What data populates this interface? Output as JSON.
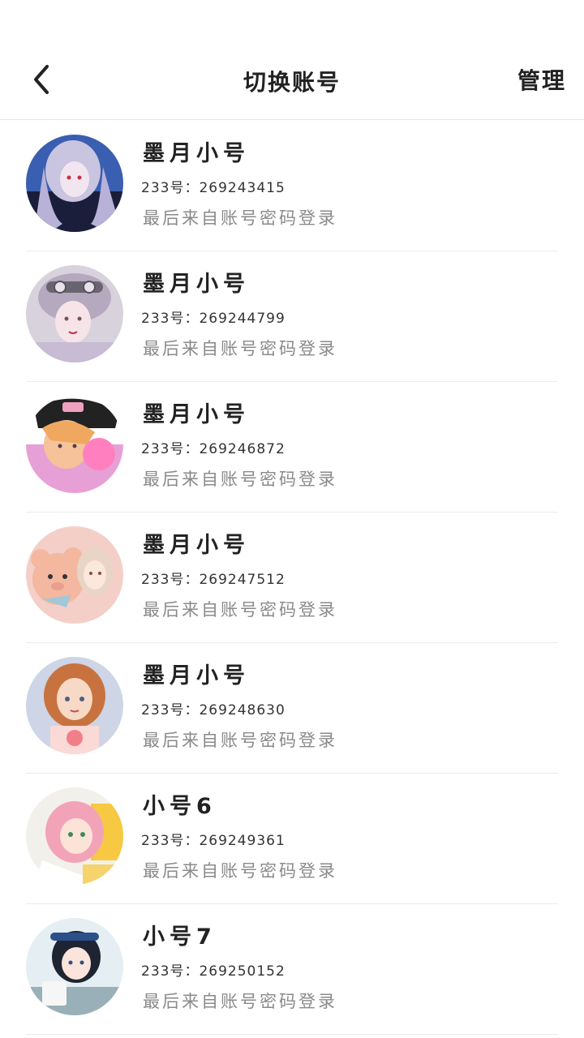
{
  "header": {
    "title": "切换账号",
    "manage_label": "管理",
    "back_icon": "chevron-left-icon"
  },
  "accounts": [
    {
      "name": "墨月小号",
      "id_line": "233号：269243415",
      "source": "最后来自账号密码登录"
    },
    {
      "name": "墨月小号",
      "id_line": "233号：269244799",
      "source": "最后来自账号密码登录"
    },
    {
      "name": "墨月小号",
      "id_line": "233号：269246872",
      "source": "最后来自账号密码登录"
    },
    {
      "name": "墨月小号",
      "id_line": "233号：269247512",
      "source": "最后来自账号密码登录"
    },
    {
      "name": "墨月小号",
      "id_line": "233号：269248630",
      "source": "最后来自账号密码登录"
    },
    {
      "name": "小号6",
      "id_line": "233号：269249361",
      "source": "最后来自账号密码登录"
    },
    {
      "name": "小号7",
      "id_line": "233号：269250152",
      "source": "最后来自账号密码登录"
    }
  ]
}
